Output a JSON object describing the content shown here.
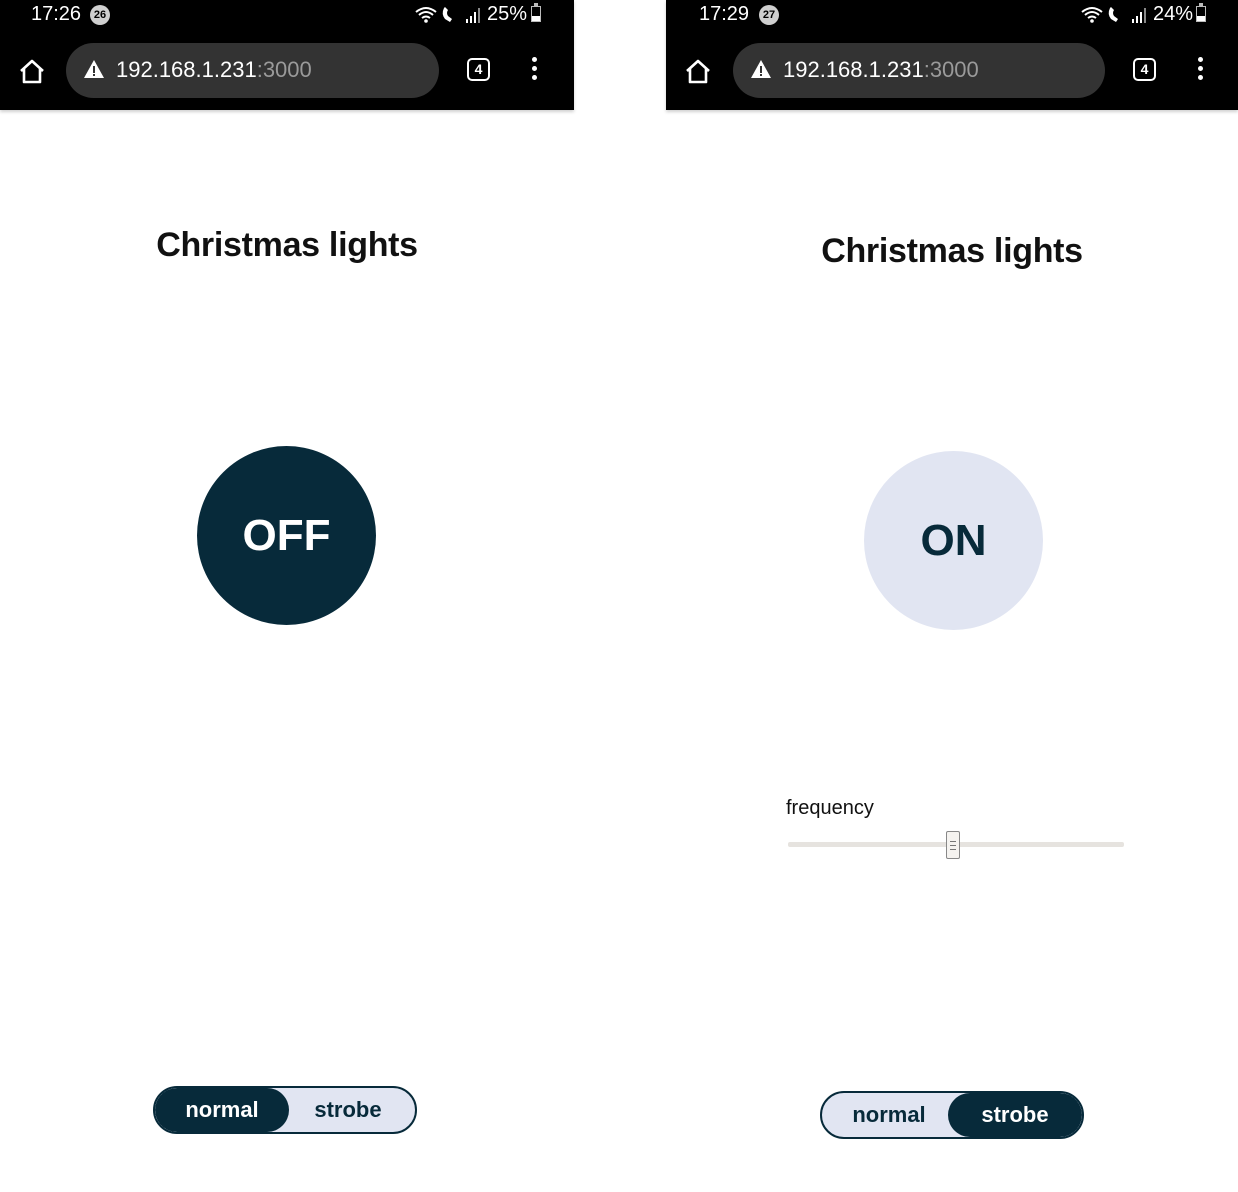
{
  "screens": [
    {
      "status": {
        "time": "17:26",
        "notification_count": "26",
        "battery": "25%"
      },
      "browser": {
        "url_host": "192.168.1.231",
        "url_port": ":3000",
        "tab_count": "4"
      },
      "page": {
        "title": "Christmas lights",
        "power_label": "OFF",
        "modes": [
          "normal",
          "strobe"
        ],
        "selected_mode": "normal"
      }
    },
    {
      "status": {
        "time": "17:29",
        "notification_count": "27",
        "battery": "24%"
      },
      "browser": {
        "url_host": "192.168.1.231",
        "url_port": ":3000",
        "tab_count": "4"
      },
      "page": {
        "title": "Christmas lights",
        "power_label": "ON",
        "frequency_label": "frequency",
        "frequency_value_fraction": 0.49,
        "modes": [
          "normal",
          "strobe"
        ],
        "selected_mode": "strobe"
      }
    }
  ],
  "colors": {
    "primary_dark": "#072a3a",
    "primary_light": "#e1e5f2",
    "browser_bar": "#000000",
    "url_field": "#333333"
  },
  "icons": [
    "home-icon",
    "warning-icon",
    "tabs-icon",
    "menu-dots-icon",
    "wifi-icon",
    "signal-icon",
    "battery-icon"
  ]
}
